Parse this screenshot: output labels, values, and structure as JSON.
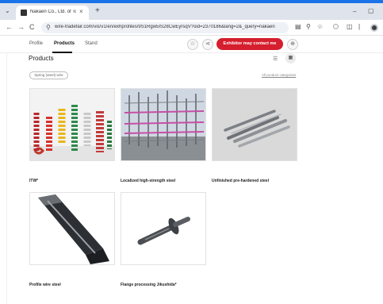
{
  "browser": {
    "tab_dropdown": "⌄",
    "tab_title": "Nakaen Co., Ltd. of Tokyo at wire",
    "tab_close": "×",
    "new_tab": "+",
    "win_min": "–",
    "win_max": "▢",
    "back": "←",
    "forward": "→",
    "reload": "C",
    "url": "wire-tradefair.com/vis/v1/en/exhprofiles/9S1Rgw5IS28CwEyrsqV?oid=2370186&lang=2&_query=nakaen",
    "accent_color": "#1a73e8"
  },
  "site_nav": {
    "items": [
      "Profile",
      "Products",
      "Stand"
    ],
    "exhibitor_button": "Exhibitor may contact me",
    "brand_color": "#d51e2e"
  },
  "content": {
    "section_title": "Products",
    "filter_chip": "Spring (steel) wire",
    "all_categories": "All product categories",
    "products": [
      {
        "name": "ITW*"
      },
      {
        "name": "Localized high-strength steel"
      },
      {
        "name": "Unfinished pre-hardened steel"
      },
      {
        "name": "Profile wire steel"
      },
      {
        "name": "Flange processing Jikushida*"
      }
    ]
  }
}
